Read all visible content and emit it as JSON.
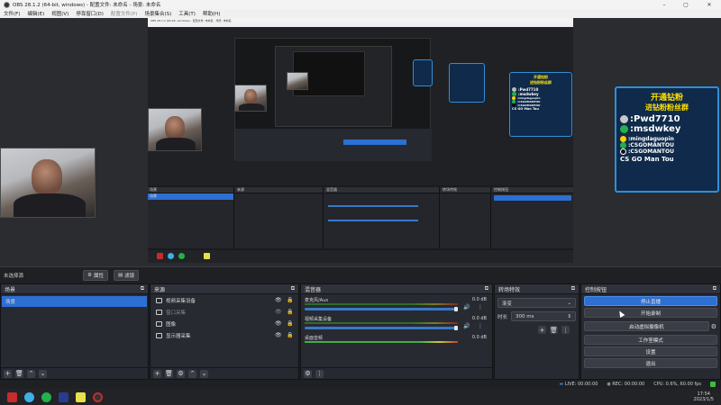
{
  "window": {
    "title": "OBS 28.1.2 (64-bit, windows) - 配置文件: 未命名 - 场景: 未命名"
  },
  "menu": [
    "文件(F)",
    "编辑(E)",
    "视图(V)",
    "停靠窗口(D)",
    "配置文件(P)",
    "场景集合(S)",
    "工具(T)",
    "帮助(H)"
  ],
  "poster": {
    "line1": "开通钻粉",
    "line2": "进钻粉粉丝群",
    "handle1": ":Pwd7710",
    "handle2": ":msdwkey",
    "handle3": ":mingdaguopin",
    "handle4": ":CSGOMANTOU",
    "handle5": ":CSGOMANTOU",
    "footer": "CS GO Man Tou"
  },
  "scene_bar": {
    "current": "未选择源",
    "properties": "属性",
    "filters": "滤镜"
  },
  "scenes": {
    "title": "场景",
    "items": [
      "场景"
    ]
  },
  "sources": {
    "title": "来源",
    "items": [
      "视频采集设备",
      "窗口采集",
      "图像",
      "显示器采集"
    ]
  },
  "mixer": {
    "title": "混音器",
    "channels": [
      {
        "name": "麦克风/Aux",
        "db": "0.0 dB"
      },
      {
        "name": "视频采集设备",
        "db": "0.0 dB"
      },
      {
        "name": "桌面音频",
        "db": "0.0 dB"
      }
    ],
    "scale": [
      "-60",
      "-55",
      "-50",
      "-45",
      "-40",
      "-35",
      "-30",
      "-25",
      "-20",
      "-15",
      "-10",
      "-5",
      "0"
    ]
  },
  "transitions": {
    "title": "转场特效",
    "type": "渐变",
    "duration_label": "时长",
    "duration": "300 ms"
  },
  "controls": {
    "title": "控制按钮",
    "buttons": [
      "停止直播",
      "开始录制",
      "启动虚拟摄像机",
      "工作室模式",
      "设置",
      "退出"
    ]
  },
  "status": {
    "live": "LIVE: 00:00:00",
    "rec": "REC: 00:00:00",
    "cpu": "CPU: 0.6%, 60.00 fps"
  },
  "taskbar": {
    "time": "17:54",
    "date": "2023/1/5"
  },
  "colors": {
    "accent": "#2d6fd2",
    "panel": "#272a31",
    "poster_border": "#2f8fd8",
    "poster_text": "#ffe100"
  }
}
